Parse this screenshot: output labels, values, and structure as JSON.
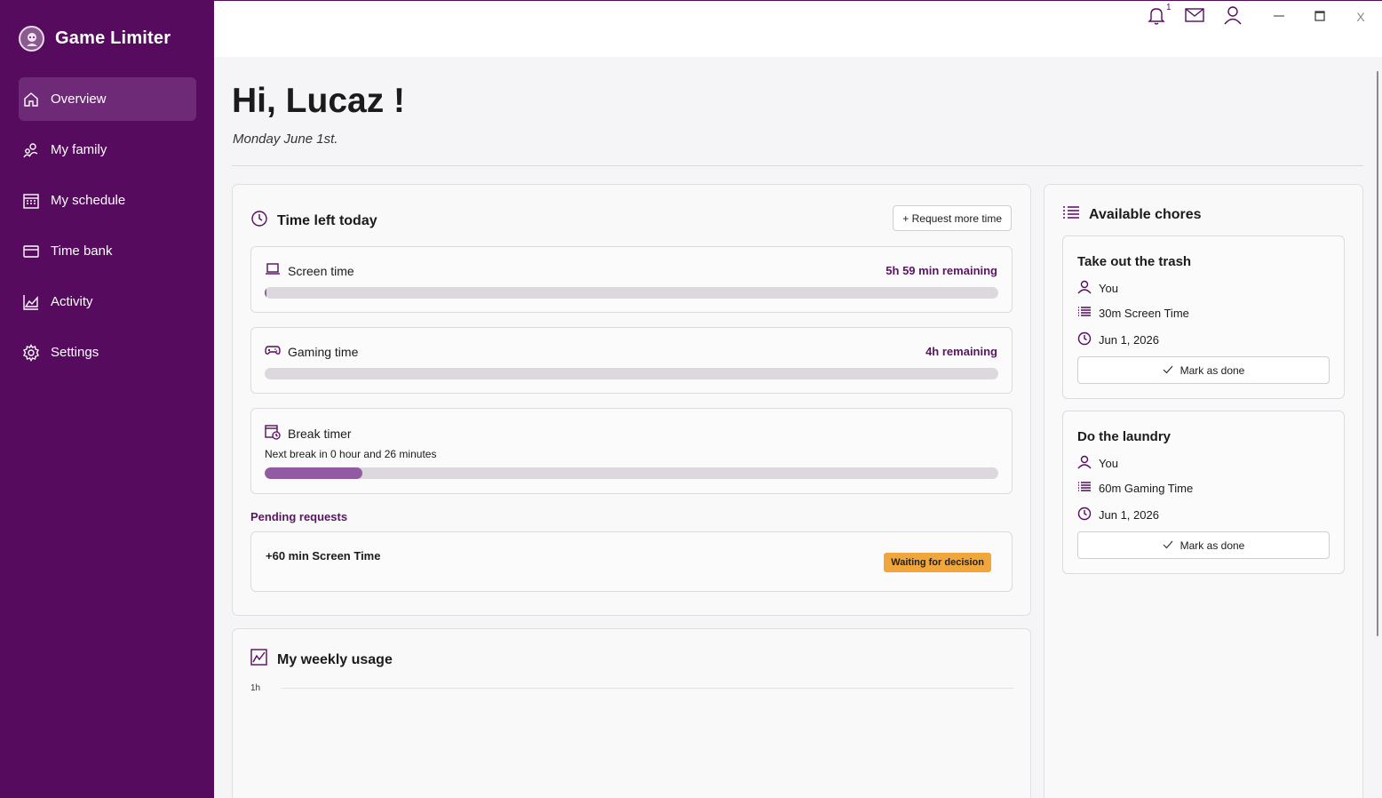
{
  "app": {
    "title": "Game Limiter"
  },
  "sidebar": {
    "items": [
      {
        "label": "Overview",
        "icon": "home-icon",
        "active": true
      },
      {
        "label": "My family",
        "icon": "family-icon",
        "active": false
      },
      {
        "label": "My schedule",
        "icon": "calendar-icon",
        "active": false
      },
      {
        "label": "Time bank",
        "icon": "card-icon",
        "active": false
      },
      {
        "label": "Activity",
        "icon": "chart-icon",
        "active": false
      },
      {
        "label": "Settings",
        "icon": "gear-icon",
        "active": false
      }
    ]
  },
  "titlebar": {
    "notification_count": "1",
    "close_label": "X"
  },
  "header": {
    "greeting": "Hi, Lucaz !",
    "date": "Monday June 1st."
  },
  "time_left": {
    "title": "Time left today",
    "request_button": "+ Request more time",
    "screen": {
      "label": "Screen time",
      "remaining": "5h 59 min remaining",
      "progress": 0.002
    },
    "gaming": {
      "label": "Gaming time",
      "remaining": "4h remaining",
      "progress": 0
    },
    "break": {
      "label": "Break timer",
      "next": "Next break in 0 hour and 26 minutes",
      "progress": 0.133
    }
  },
  "pending": {
    "title": "Pending requests",
    "items": [
      {
        "text": "+60 min Screen Time",
        "status": "Waiting for decision"
      }
    ]
  },
  "weekly": {
    "title": "My weekly usage",
    "y_label": "1h"
  },
  "chores": {
    "title": "Available chores",
    "items": [
      {
        "title": "Take out the trash",
        "assignee": "You",
        "reward": "30m Screen Time",
        "date": "Jun 1, 2026",
        "button": "Mark as done"
      },
      {
        "title": "Do the laundry",
        "assignee": "You",
        "reward": "60m Gaming Time",
        "date": "Jun 1, 2026",
        "button": "Mark as done"
      }
    ]
  },
  "colors": {
    "sidebar": "#560b5e",
    "accent": "#5a1462",
    "progress": "#915aa3",
    "badge": "#f0a63a"
  }
}
